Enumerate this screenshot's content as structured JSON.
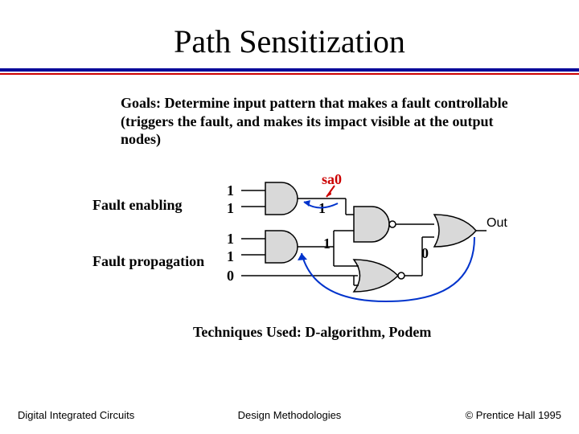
{
  "title": "Path Sensitization",
  "goals": "Goals: Determine input pattern that makes a fault controllable (triggers the fault, and makes its impact visible at the output nodes)",
  "labels": {
    "fault_enabling": "Fault enabling",
    "fault_propagation": "Fault propagation",
    "sa0": "sa0",
    "out": "Out"
  },
  "signals": {
    "in0": "1",
    "in1": "1",
    "in2": "1",
    "in3": "1",
    "in4": "0",
    "mid_top": "1",
    "mid_bot": "1",
    "nor_out": "0"
  },
  "techniques": "Techniques Used: D-algorithm, Podem",
  "footer": {
    "left": "Digital Integrated Circuits",
    "center": "Design Methodologies",
    "right": "© Prentice Hall 1995"
  }
}
